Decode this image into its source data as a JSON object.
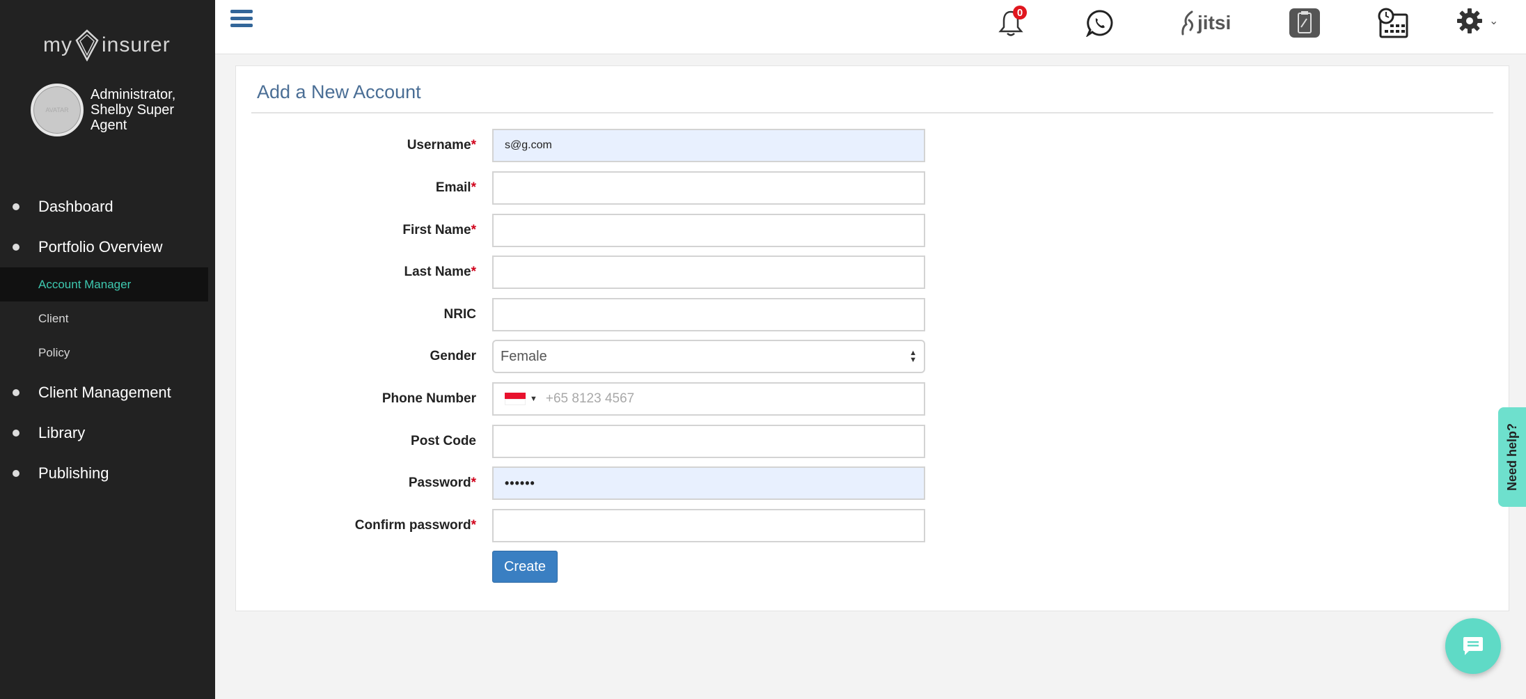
{
  "brand": {
    "logo_left": "my",
    "logo_right": "insurer"
  },
  "profile": {
    "name": "Administrator, Shelby Super Agent",
    "avatar_text": "AVATAR"
  },
  "sidebar": {
    "items": [
      {
        "label": "Dashboard"
      },
      {
        "label": "Portfolio Overview",
        "subitems": [
          {
            "label": "Account Manager",
            "active": true
          },
          {
            "label": "Client"
          },
          {
            "label": "Policy"
          }
        ]
      },
      {
        "label": "Client Management"
      },
      {
        "label": "Library"
      },
      {
        "label": "Publishing"
      }
    ]
  },
  "topbar": {
    "notifications_count": "0",
    "jitsi_label": "jitsi",
    "icons": [
      "menu-icon",
      "bell-icon",
      "whatsapp-icon",
      "jitsi-icon",
      "clipboard-icon",
      "calendar-clock-icon",
      "gear-icon"
    ]
  },
  "form": {
    "title": "Add a New Account",
    "fields": {
      "username": {
        "label": "Username",
        "required": "*",
        "value": "s@g.com"
      },
      "email": {
        "label": "Email",
        "required": "*",
        "value": ""
      },
      "first_name": {
        "label": "First Name",
        "required": "*",
        "value": ""
      },
      "last_name": {
        "label": "Last Name",
        "required": "*",
        "value": ""
      },
      "nric": {
        "label": "NRIC",
        "value": ""
      },
      "gender": {
        "label": "Gender",
        "value": "Female"
      },
      "phone": {
        "label": "Phone Number",
        "placeholder": "+65 8123 4567",
        "country": "SG"
      },
      "post_code": {
        "label": "Post Code",
        "value": ""
      },
      "password": {
        "label": "Password",
        "required": "*",
        "value": "••••••"
      },
      "confirm_password": {
        "label": "Confirm password",
        "required": "*",
        "value": ""
      }
    },
    "submit_label": "Create"
  },
  "help": {
    "label": "Need help?"
  },
  "colors": {
    "sidebar_bg": "#222222",
    "accent": "#3ec9b0",
    "primary": "#3a7fc2",
    "title": "#4a6e95",
    "badge": "#e0161e"
  }
}
